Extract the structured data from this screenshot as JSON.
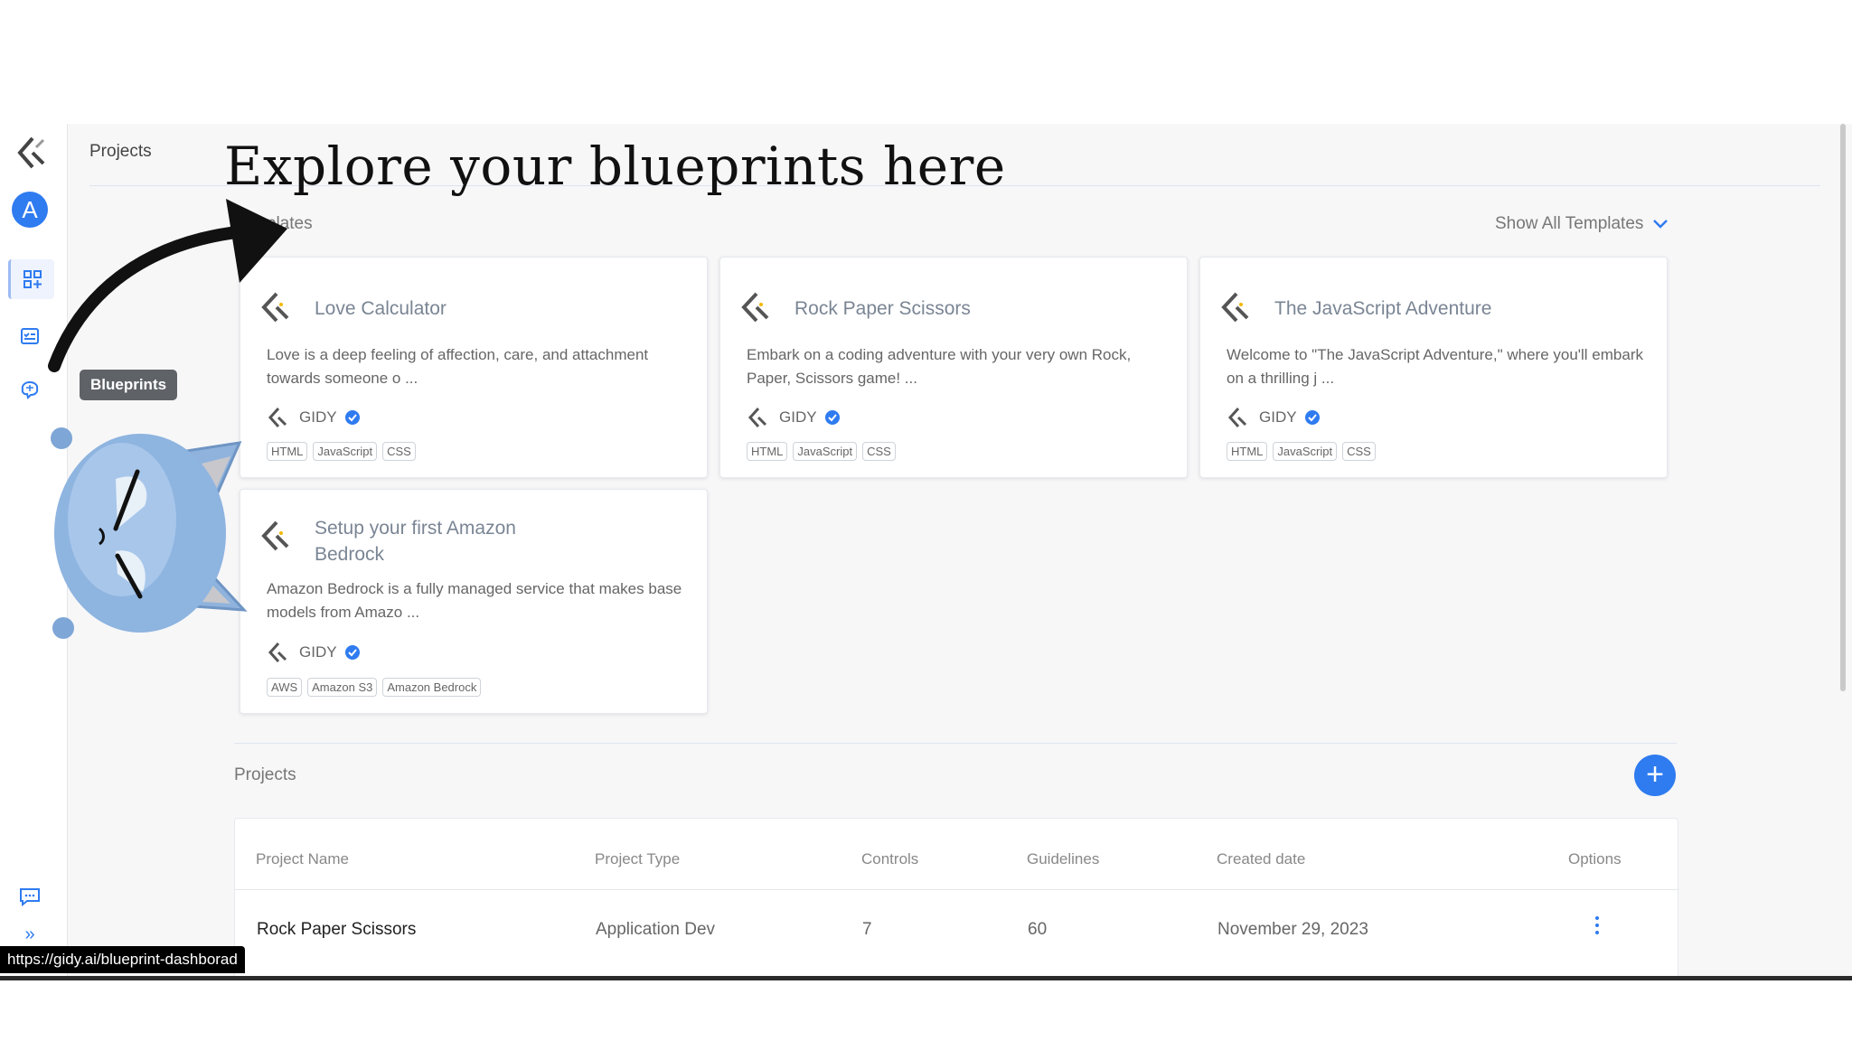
{
  "headline": "Explore your blueprints here",
  "breadcrumb": "Projects",
  "sidebar": {
    "avatar_letter": "A",
    "tooltip": "Blueprints",
    "icons": [
      "gidy-logo-icon",
      "dashboard-grid-icon",
      "checklist-icon",
      "brain-icon",
      "chat-icon",
      "expand-icon"
    ]
  },
  "templates": {
    "label": "Templates",
    "show_all": "Show All Templates",
    "cards": [
      {
        "title": "Love Calculator",
        "description": "Love is a deep feeling of affection, care, and attachment towards someone o ...",
        "author": "GIDY",
        "tags": [
          "HTML",
          "JavaScript",
          "CSS"
        ]
      },
      {
        "title": "Rock Paper Scissors",
        "description": "Embark on a coding adventure with your very own Rock, Paper, Scissors game! ...",
        "author": "GIDY",
        "tags": [
          "HTML",
          "JavaScript",
          "CSS"
        ]
      },
      {
        "title": "The JavaScript Adventure",
        "description": "Welcome to \"The JavaScript Adventure,\" where you'll embark on a thrilling j ...",
        "author": "GIDY",
        "tags": [
          "HTML",
          "JavaScript",
          "CSS"
        ]
      },
      {
        "title": "Setup your first Amazon Bedrock",
        "description": "Amazon Bedrock is a fully managed service that makes base models from Amazo ...",
        "author": "GIDY",
        "tags": [
          "AWS",
          "Amazon S3",
          "Amazon Bedrock"
        ]
      }
    ]
  },
  "projects": {
    "label": "Projects",
    "add_symbol": "+",
    "columns": [
      "Project Name",
      "Project Type",
      "Controls",
      "Guidelines",
      "Created date",
      "Options"
    ],
    "rows": [
      {
        "name": "Rock Paper Scissors",
        "type": "Application Dev",
        "controls": "7",
        "guidelines": "60",
        "created": "November 29, 2023"
      }
    ]
  },
  "status_url": "https://gidy.ai/blueprint-dashborad",
  "colors": {
    "accent": "#2f7bf0",
    "background": "#f7f7f8"
  }
}
